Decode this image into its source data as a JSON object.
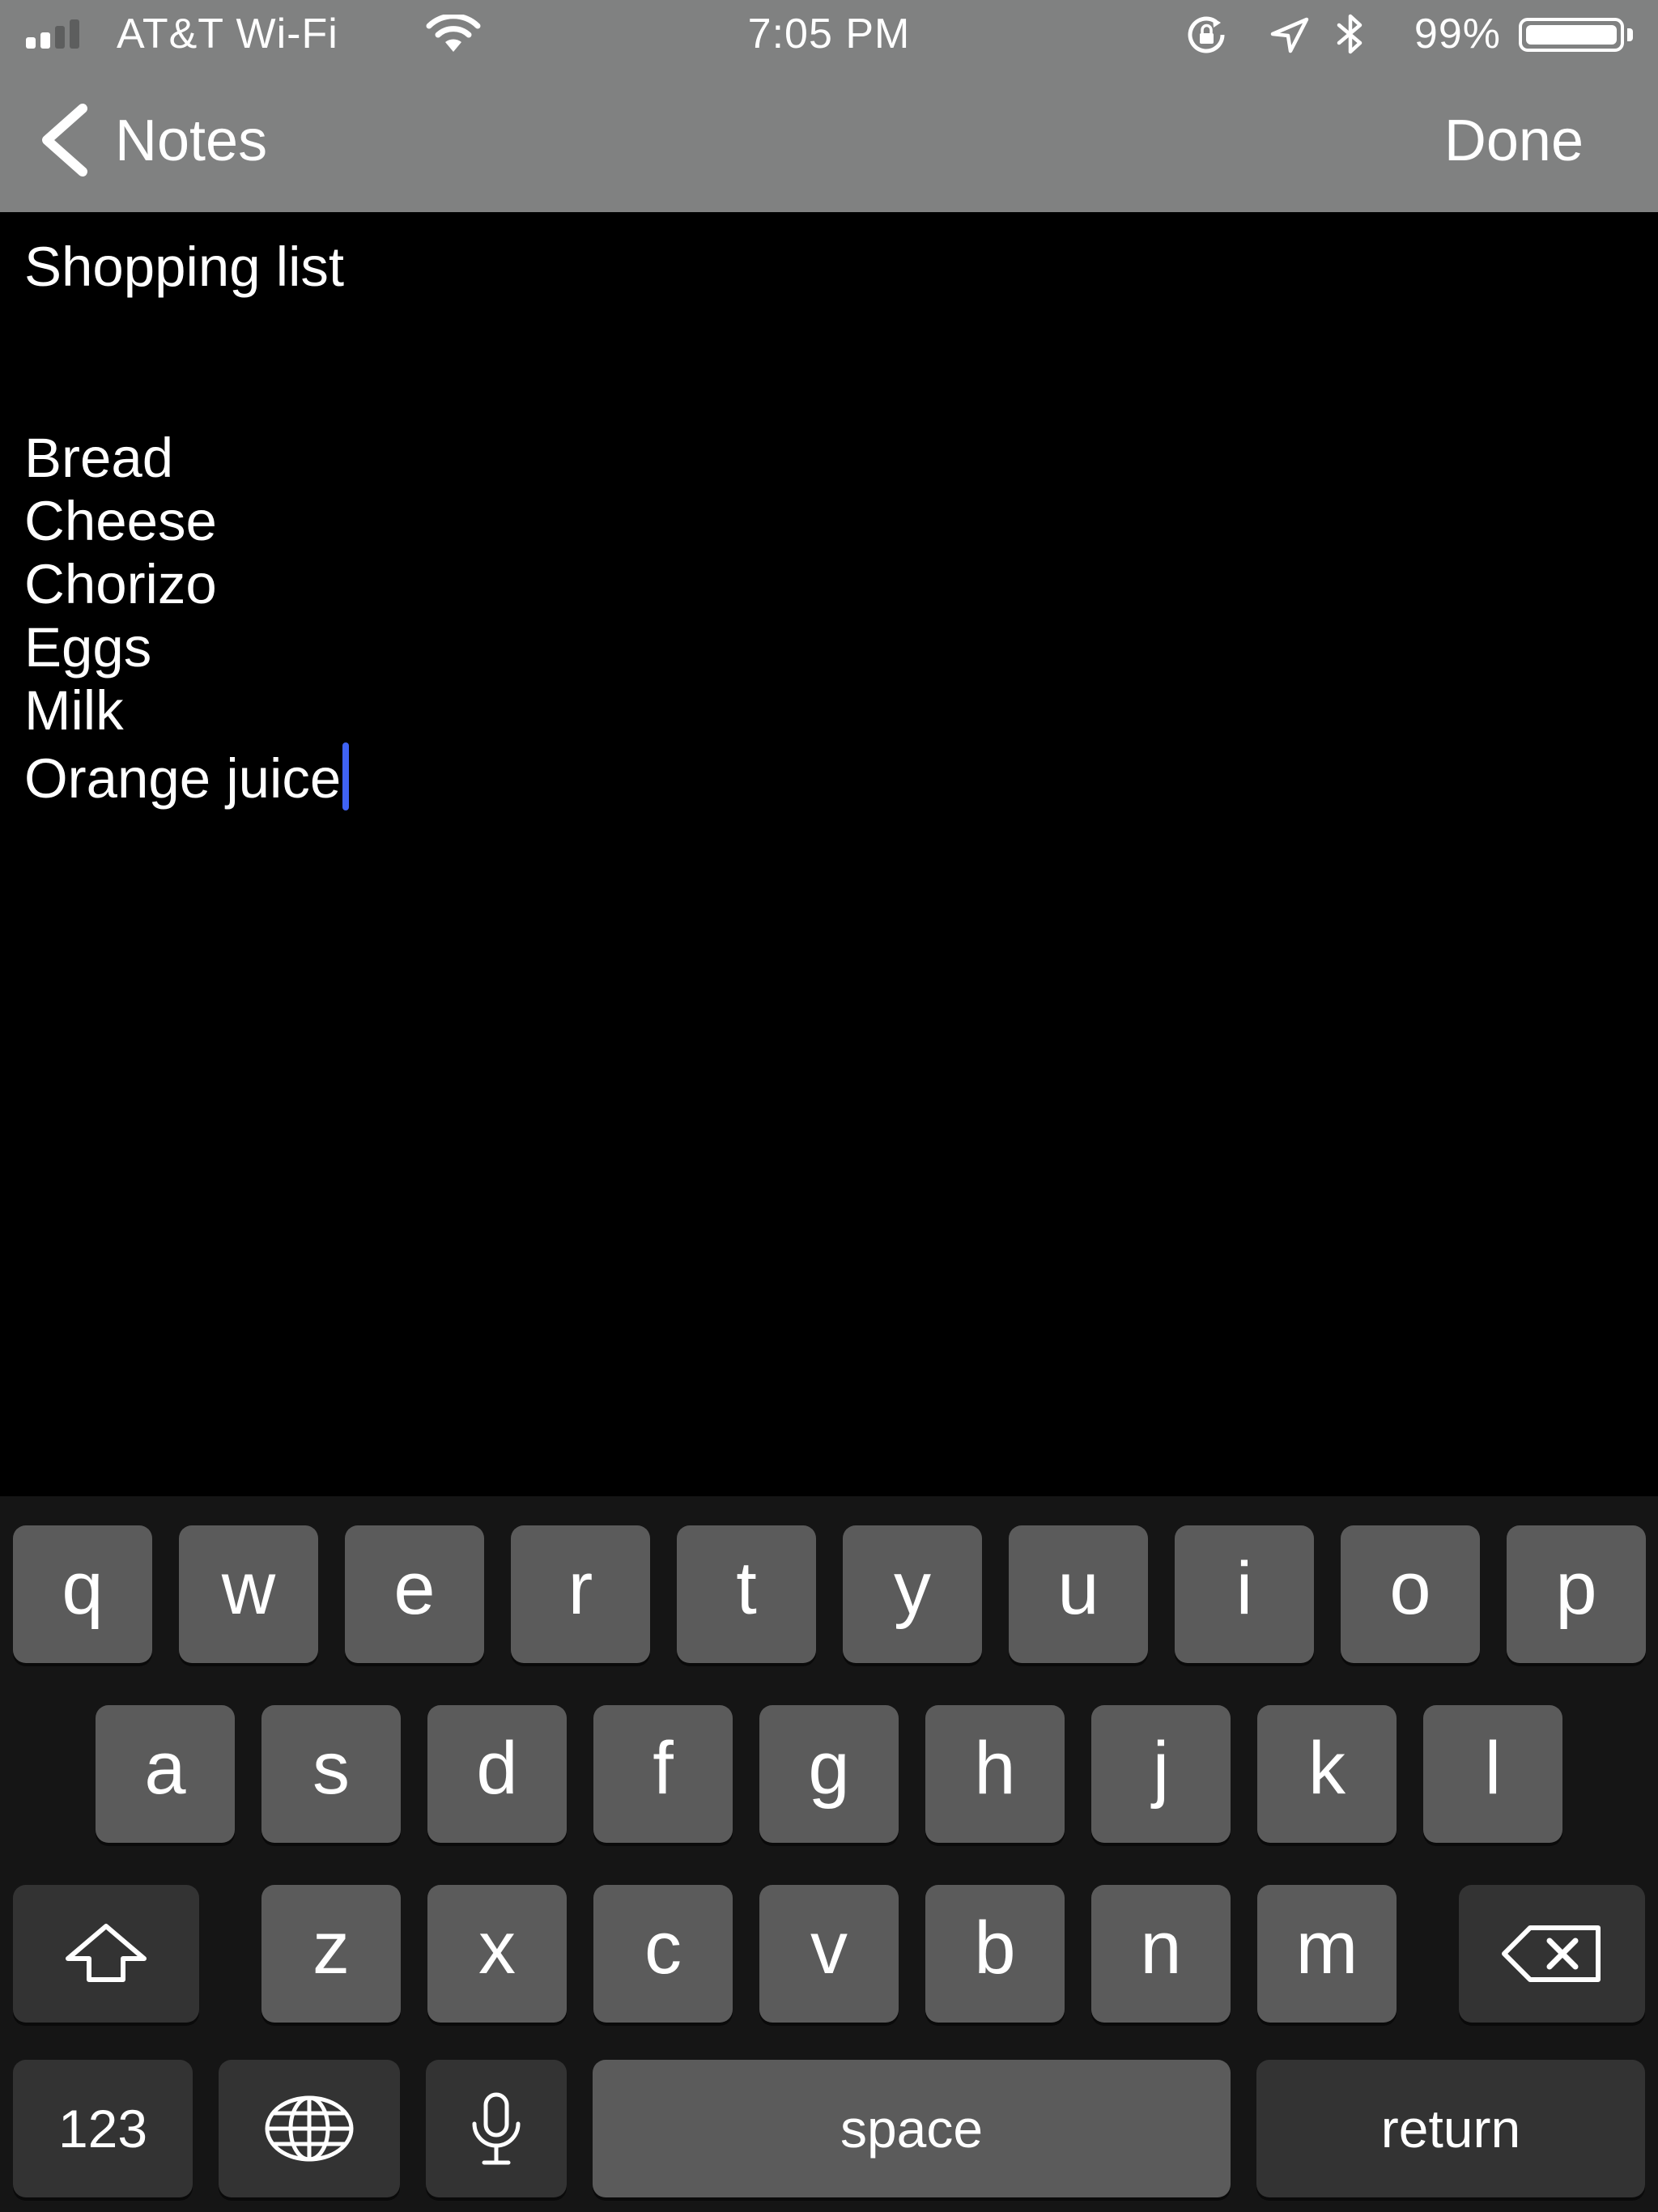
{
  "status_bar": {
    "carrier": "AT&T Wi-Fi",
    "time": "7:05 PM",
    "battery_percent": "99%",
    "signal_bars_filled": 2,
    "signal_bars_total": 4,
    "icons": [
      "signal-icon",
      "wifi-icon",
      "orientation-lock-icon",
      "location-icon",
      "bluetooth-icon",
      "battery-icon"
    ]
  },
  "nav": {
    "back_label": "Notes",
    "done_label": "Done"
  },
  "note": {
    "title": "Shopping list",
    "items": [
      "Bread",
      "Cheese",
      "Chorizo",
      "Eggs",
      "Milk",
      "Orange juice"
    ],
    "caret_color": "#3f63f5"
  },
  "keyboard": {
    "row1": [
      "q",
      "w",
      "e",
      "r",
      "t",
      "y",
      "u",
      "i",
      "o",
      "p"
    ],
    "row2": [
      "a",
      "s",
      "d",
      "f",
      "g",
      "h",
      "j",
      "k",
      "l"
    ],
    "row3": [
      "z",
      "x",
      "c",
      "v",
      "b",
      "n",
      "m"
    ],
    "shift_icon": "shift-icon",
    "delete_icon": "delete-icon",
    "numbers_label": "123",
    "globe_icon": "globe-icon",
    "mic_icon": "microphone-icon",
    "space_label": "space",
    "return_label": "return"
  },
  "colors": {
    "bar_background": "#808181",
    "note_background": "#000000",
    "keyboard_background": "#151515",
    "key_light": "#5b5b5b",
    "key_dark": "#333333"
  }
}
